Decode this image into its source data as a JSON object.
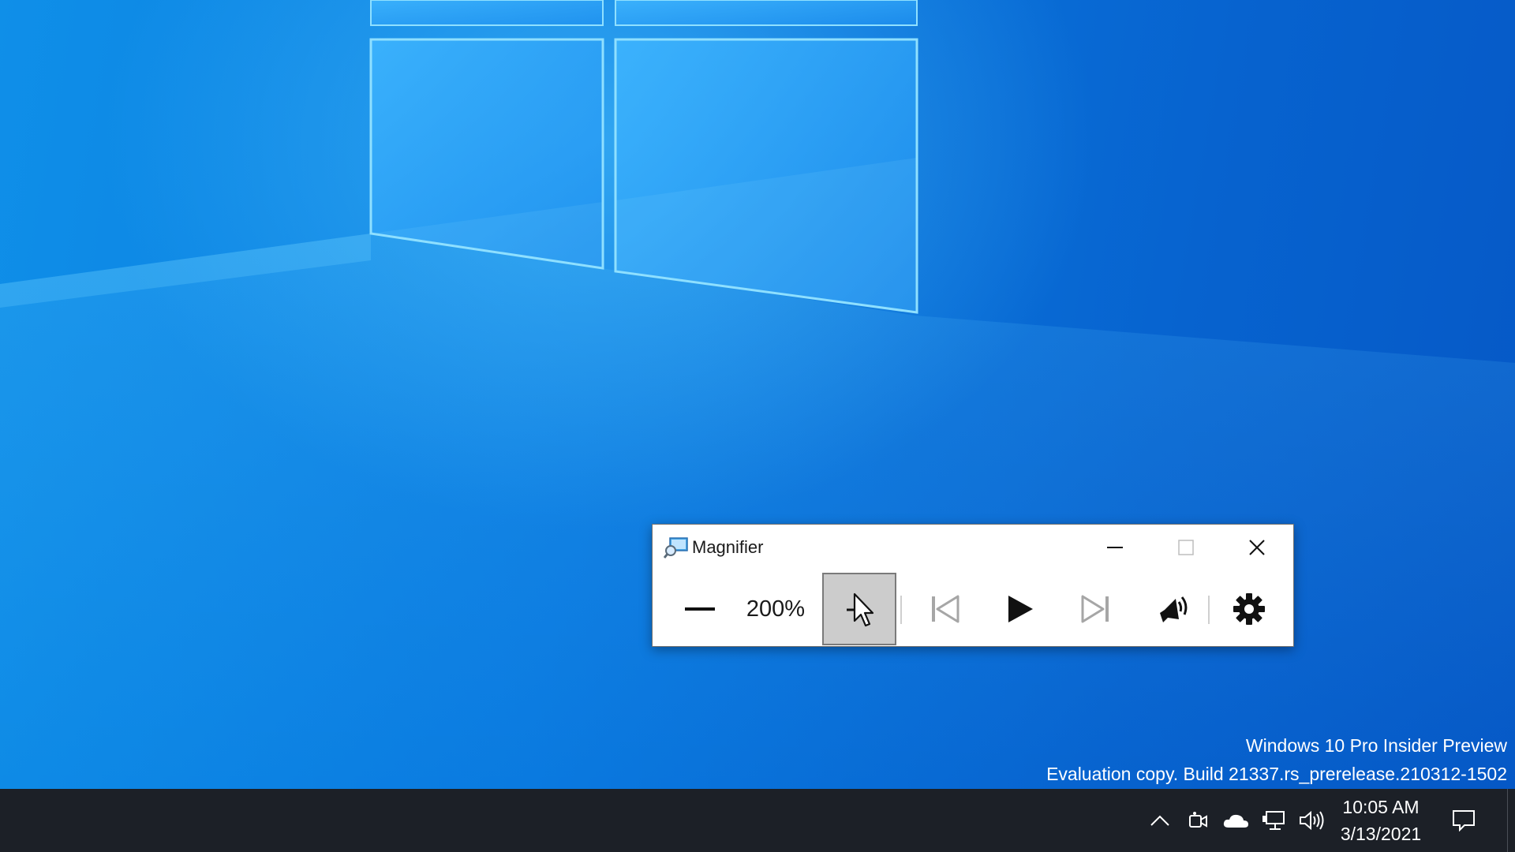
{
  "window": {
    "title": "Magnifier",
    "zoom_level": "200%",
    "controls": {
      "zoom_out": "minus-icon",
      "read_from_pointer": "cursor-icon",
      "previous": "skip-previous-icon",
      "play": "play-icon",
      "next": "skip-next-icon",
      "voice": "speaker-icon",
      "settings": "gear-icon"
    },
    "caption": {
      "minimize": "minimize-icon",
      "maximize": "maximize-icon",
      "close": "close-icon"
    }
  },
  "watermark": {
    "line1": "Windows 10 Pro Insider Preview",
    "line2": "Evaluation copy. Build 21337.rs_prerelease.210312-1502"
  },
  "taskbar": {
    "time": "10:05 AM",
    "date": "3/13/2021",
    "tray_icons": [
      "chevron-up-icon",
      "meet-now-icon",
      "onedrive-icon",
      "network-icon",
      "volume-icon"
    ],
    "notification_icon": "notification-icon"
  },
  "colors": {
    "taskbar": "#1c2027",
    "desktop_blue": "#0a6fd4",
    "active_tool_bg": "#cccccc"
  }
}
